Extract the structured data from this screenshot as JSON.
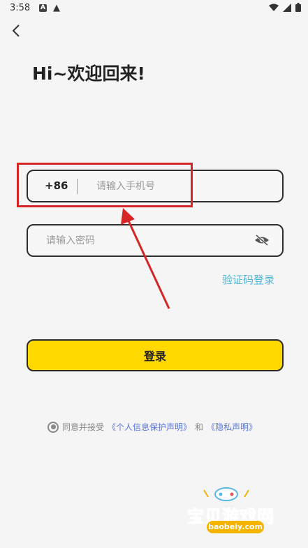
{
  "status_bar": {
    "time": "3:58",
    "icons": [
      "a-notification-icon",
      "warning-icon",
      "wifi-icon",
      "signal-icon",
      "battery-icon"
    ]
  },
  "header": {
    "back_icon": "back-icon"
  },
  "title": "Hi~欢迎回来!",
  "phone": {
    "country_code": "+86",
    "placeholder": "请输入手机号"
  },
  "password": {
    "placeholder": "请输入密码",
    "toggle_icon": "eye-off-icon"
  },
  "code_login_label": "验证码登录",
  "login_button_label": "登录",
  "agreement": {
    "prefix": "同意并接受",
    "privacy_statement": "《个人信息保护声明》",
    "and": "和",
    "privacy_policy": "《隐私声明》"
  },
  "watermark": {
    "name": "宝贝游戏网",
    "url": "baobeiy.com"
  },
  "colors": {
    "accent_yellow": "#ffd800",
    "link_blue": "#4fb4d8",
    "agreement_link": "#5b78d6",
    "highlight_red": "#d62525",
    "background": "#f5f5f5"
  }
}
